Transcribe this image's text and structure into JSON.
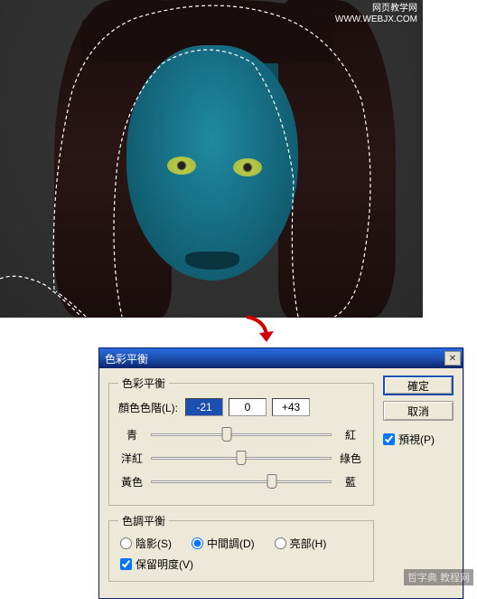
{
  "image": {
    "watermark_line1": "网页教学网",
    "watermark_line2": "WWW.WEBJX.COM"
  },
  "bottom_watermark": "哲字典 教程网",
  "dialog": {
    "title": "色彩平衡",
    "group_balance": "色彩平衡",
    "level_label": "顏色色階(L):",
    "level_values": [
      "-21",
      "0",
      "+43"
    ],
    "slider_left": [
      "青",
      "洋紅",
      "黃色"
    ],
    "slider_right": [
      "紅",
      "綠色",
      "藍"
    ],
    "group_tone": "色調平衡",
    "radio_shadow": "陰影(S)",
    "radio_mid": "中間調(D)",
    "radio_hi": "亮部(H)",
    "preserve": "保留明度(V)",
    "btn_ok": "確定",
    "btn_cancel": "取消",
    "preview": "預視(P)"
  }
}
